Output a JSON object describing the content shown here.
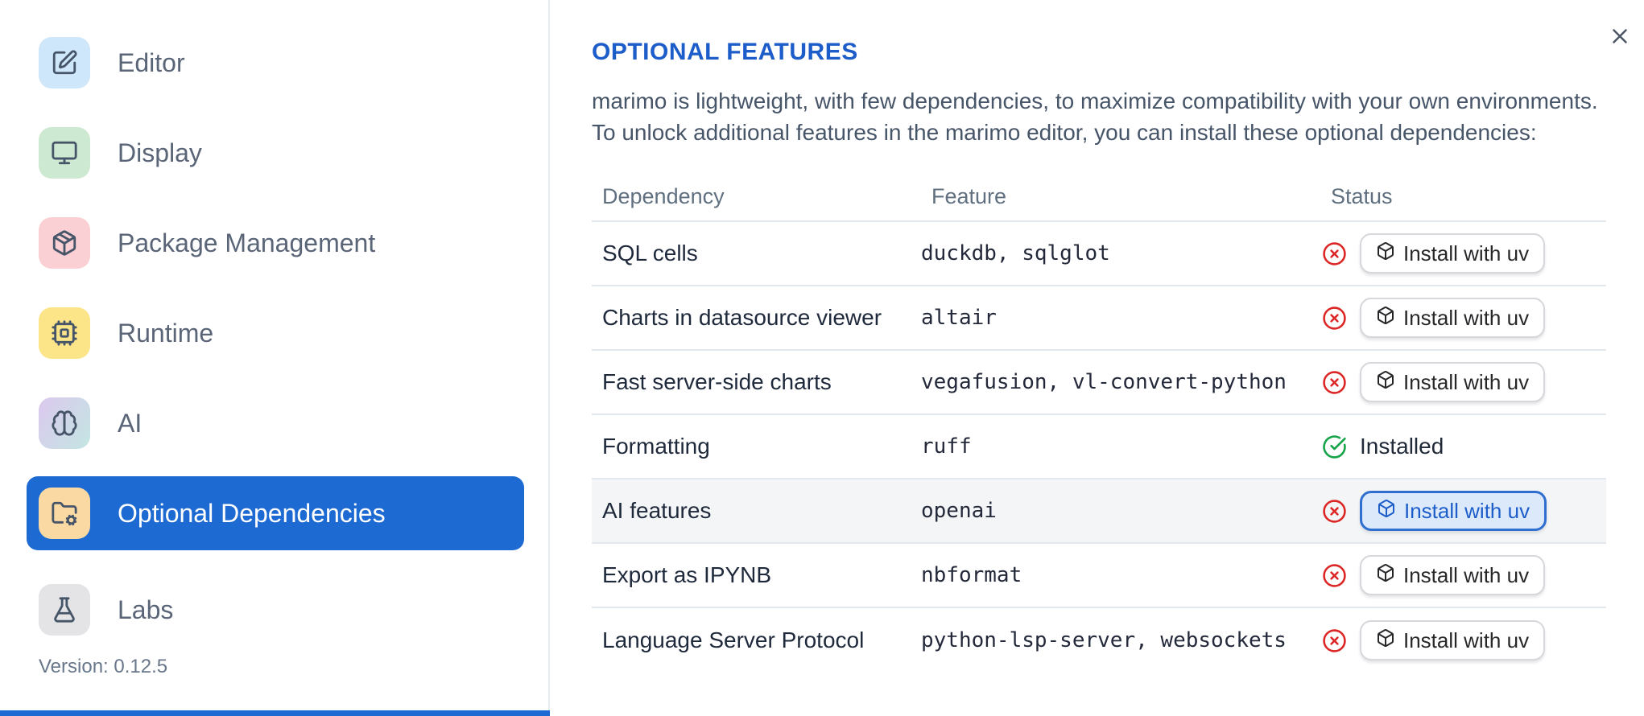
{
  "colors": {
    "accent": "#1e6ad3",
    "red": "#dc2626",
    "green": "#16a34a",
    "title_blue": "#1d5dc9"
  },
  "sidebar": {
    "items": [
      {
        "id": "editor",
        "label": "Editor",
        "icon": "square-pen-icon",
        "icon_bg": "#cfe7fa",
        "selected": false
      },
      {
        "id": "display",
        "label": "Display",
        "icon": "monitor-icon",
        "icon_bg": "#cde9d2",
        "selected": false
      },
      {
        "id": "package-management",
        "label": "Package Management",
        "icon": "package-icon",
        "icon_bg": "#fbd0d5",
        "selected": false
      },
      {
        "id": "runtime",
        "label": "Runtime",
        "icon": "cpu-icon",
        "icon_bg": "#fce588",
        "selected": false
      },
      {
        "id": "ai",
        "label": "AI",
        "icon": "brain-icon",
        "icon_bg": "linear-gradient(125deg,#dcc8ee 0%,#c3e6e2 100%)",
        "selected": false
      },
      {
        "id": "optional-dependencies",
        "label": "Optional Dependencies",
        "icon": "folder-cog-icon",
        "icon_bg": "#fbd9a3",
        "selected": true
      },
      {
        "id": "labs",
        "label": "Labs",
        "icon": "flask-icon",
        "icon_bg": "#e4e4e7",
        "selected": false
      }
    ],
    "version_label": "Version: 0.12.5"
  },
  "dialog": {
    "title": "OPTIONAL FEATURES",
    "description_line1": "marimo is lightweight, with few dependencies, to maximize compatibility with your own environments.",
    "description_line2": "To unlock additional features in the marimo editor, you can install these optional dependencies:",
    "close_icon": "x-icon"
  },
  "table": {
    "headers": [
      "Dependency",
      "Feature",
      "Status"
    ],
    "install_button_label": "Install with uv",
    "installed_label": "Installed",
    "rows": [
      {
        "dependency": "SQL cells",
        "feature": "duckdb, sqlglot",
        "installed": false,
        "highlighted": false
      },
      {
        "dependency": "Charts in datasource viewer",
        "feature": "altair",
        "installed": false,
        "highlighted": false
      },
      {
        "dependency": "Fast server-side charts",
        "feature": "vegafusion, vl-convert-python",
        "installed": false,
        "highlighted": false
      },
      {
        "dependency": "Formatting",
        "feature": "ruff",
        "installed": true,
        "highlighted": false
      },
      {
        "dependency": "AI features",
        "feature": "openai",
        "installed": false,
        "highlighted": true
      },
      {
        "dependency": "Export as IPYNB",
        "feature": "nbformat",
        "installed": false,
        "highlighted": false
      },
      {
        "dependency": "Language Server Protocol",
        "feature": "python-lsp-server, websockets",
        "installed": false,
        "highlighted": false
      }
    ]
  }
}
